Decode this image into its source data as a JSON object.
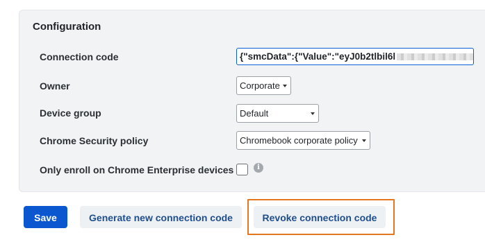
{
  "config": {
    "title": "Configuration",
    "connection_code": {
      "label": "Connection code",
      "value": "{\"smcData\":{\"Value\":\"eyJ0b2tlbil6l"
    },
    "owner": {
      "label": "Owner",
      "selected": "Corporate"
    },
    "device_group": {
      "label": "Device group",
      "selected": "Default"
    },
    "security_policy": {
      "label": "Chrome Security policy",
      "selected": "Chromebook corporate policy"
    },
    "enroll_only": {
      "label": "Only enroll on Chrome Enterprise devices",
      "checked": false,
      "info_icon": "i"
    }
  },
  "actions": {
    "save": "Save",
    "generate": "Generate new connection code",
    "revoke": "Revoke connection code"
  },
  "colors": {
    "primary": "#0b57d0",
    "highlight": "#e3761f",
    "panel_bg": "#f1f3f5"
  }
}
